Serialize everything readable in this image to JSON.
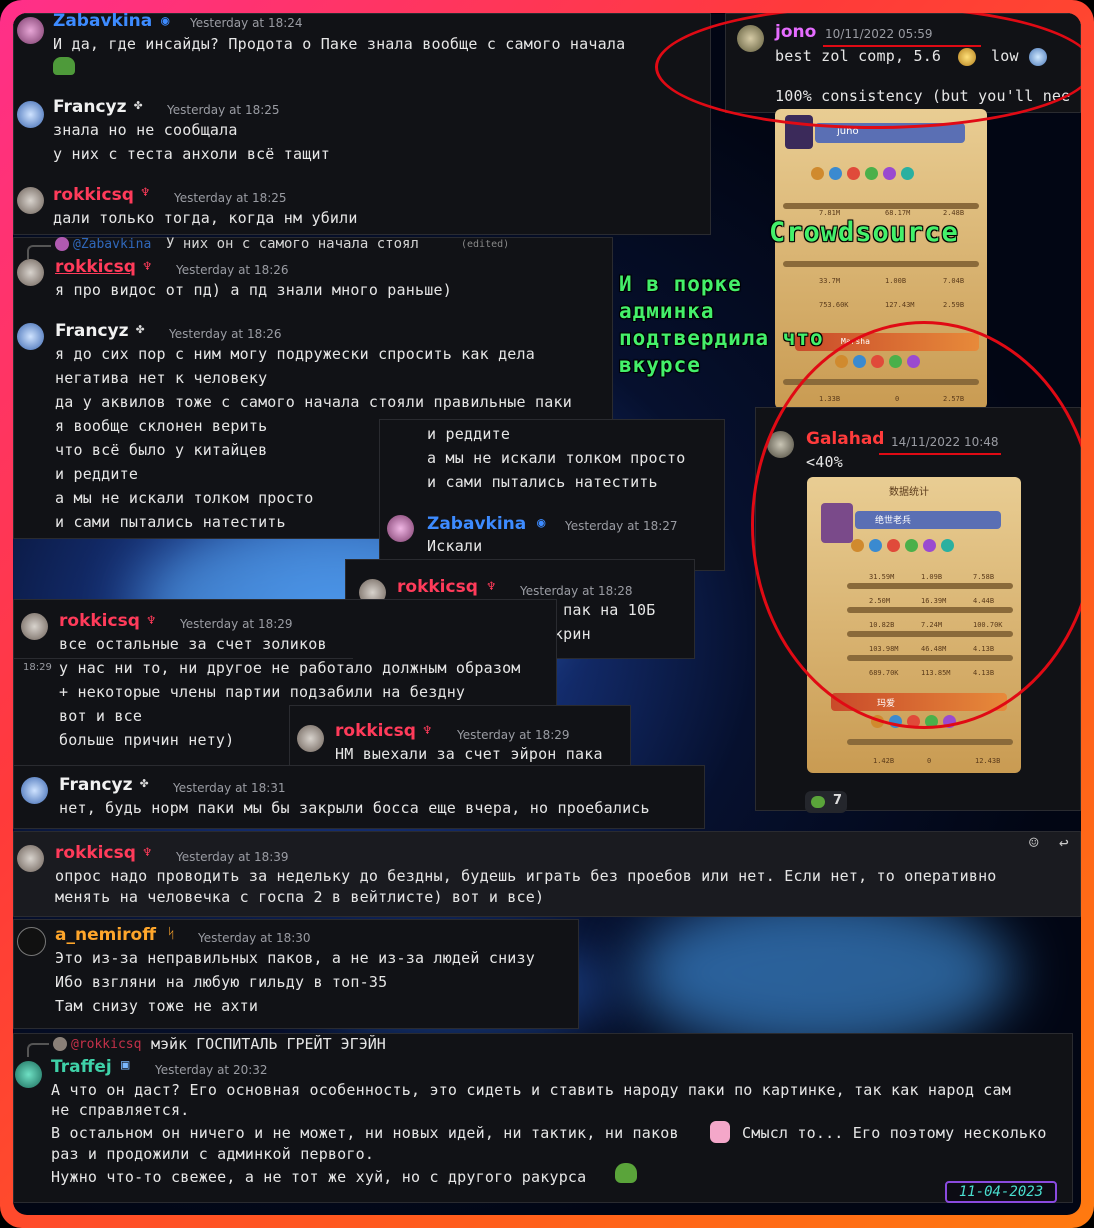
{
  "messages": {
    "m1": {
      "user": "Zabavkina",
      "time": "Yesterday at 18:24",
      "lines": [
        "И да, где инсайды? Продота о Паке знала вообще с самого начала"
      ]
    },
    "m2": {
      "user": "Francyz",
      "time": "Yesterday at 18:25",
      "lines": [
        "знала но не сообщала",
        "у них с теста анхоли всё тащит"
      ]
    },
    "m3": {
      "user": "rokkicsq",
      "time": "Yesterday at 18:25",
      "lines": [
        "дали только тогда, когда нм убили"
      ]
    },
    "m4": {
      "reply_user": "@Zabavkina",
      "reply_text": "У них он с самого начала стоял",
      "reply_edited": "(edited)",
      "user": "rokkicsq",
      "time": "Yesterday at 18:26",
      "lines": [
        "я про видос от пд) а пд знали много раньше)"
      ]
    },
    "m5": {
      "user": "Francyz",
      "time": "Yesterday at 18:26",
      "lines": [
        "я до сих пор с ним могу подружески спросить как дела",
        "негатива нет к человеку",
        "да у аквилов тоже с самого начала стояли правильные паки",
        "я вообще склонен верить",
        "что всё было у китайцев",
        "и реддите",
        "а мы не искали толком просто",
        "и сами пытались натестить"
      ]
    },
    "m6": {
      "lines": [
        "и реддите",
        "а мы не искали толком просто",
        "и сами пытались натестить"
      ],
      "user": "Zabavkina",
      "time": "Yesterday at 18:27",
      "reply": "Искали"
    },
    "m7": {
      "user": "rokkicsq",
      "time": "Yesterday at 18:28",
      "lines": [
        "но у НМ был эйрон пак на 10Б",
        "я сегодня видел скрин"
      ]
    },
    "m8": {
      "user": "rokkicsq",
      "time": "Yesterday at 18:29",
      "side_time": "18:29",
      "lines": [
        "все остальные за счет золиков",
        "у нас ни то, ни другое не работало должным образом",
        "+ некоторые члены партии подзабили на бездну",
        "вот и все",
        "больше причин нету)"
      ]
    },
    "m9": {
      "user": "rokkicsq",
      "time": "Yesterday at 18:29",
      "lines": [
        "НМ выехали за счет эйрон пака"
      ]
    },
    "m10": {
      "user": "Francyz",
      "time": "Yesterday at 18:31",
      "lines": [
        "нет, будь норм паки мы бы закрыли босса еще вчера, но проебались"
      ]
    },
    "m11": {
      "user": "rokkicsq",
      "time": "Yesterday at 18:39",
      "lines": [
        "опрос надо проводить за недельку до бездны, будешь играть без проебов или нет. Если нет, то оперативно",
        "менять на человечка с госпа 2 в вейтлисте) вот и все)"
      ]
    },
    "m12": {
      "user": "a_nemiroff",
      "time": "Yesterday at 18:30",
      "lines": [
        "Это из-за неправильных паков, а не из-за людей снизу",
        "Ибо взгляни на любую гильду в топ-35",
        "Там снизу тоже не ахти"
      ]
    },
    "m13": {
      "reply_user": "@rokkicsq",
      "reply_text": "мэйк ГОСПИТАЛЬ ГРЕЙТ ЭГЭЙН",
      "user": "Traffej",
      "time": "Yesterday at 20:32",
      "lines": [
        "А что он даст? Его основная особенность, это сидеть и ставить народу паки по картинке, так как народ сам",
        "не справляется.",
        "В остальном он ничего и не может, ни новых идей, ни тактик, ни паков",
        "Смысл то... Его поэтому несколько",
        "раз и продожили с админкой первого.",
        "Нужно что-то свежее, а не тот же хуй, но с другого ракурса"
      ]
    },
    "jono": {
      "user": "jono",
      "time": "10/11/2022 05:59",
      "line1": "best zol comp, 5.6",
      "line1b": "low",
      "line2": "100% consistency (but you'll nee"
    },
    "galahad": {
      "user": "Galahad",
      "time": "14/11/2022 10:48",
      "line1": "<40%",
      "reaction_count": "7"
    }
  },
  "game1": {
    "name": "juno",
    "tag": "Marsha",
    "stats": [
      "7.81M",
      "68.17M",
      "2.48B",
      "33.7M",
      "1.00B",
      "7.04B",
      "753.60K",
      "127.43M",
      "2.59B",
      "1.33B",
      "0",
      "2.57B"
    ]
  },
  "game2": {
    "title": "数据统计",
    "name": "绝世老兵",
    "tag": "玛爱",
    "stats": [
      "31.59M",
      "1.09B",
      "7.58B",
      "2.50M",
      "16.39M",
      "4.44B",
      "10.82B",
      "7.24M",
      "100.70K",
      "103.98M",
      "46.48M",
      "4.13B",
      "689.70K",
      "113.85M",
      "4.13B",
      "1.42B",
      "0",
      "12.43B"
    ]
  },
  "overlay": {
    "crowdsource": "Crowdsource",
    "note_lines": [
      "И в порке",
      "админка",
      "подтвердила что",
      "вкурсе"
    ],
    "date_stamp": "11-04-2023"
  },
  "colors": {
    "frame_gradient_start": "#ff2f8a",
    "frame_gradient_end": "#ff7a10",
    "circle": "#e00a14",
    "green_text": "#44f06a",
    "zabavkina": "#3d8bff",
    "rokkicsq": "#ff3b5a",
    "francyz": "#f1f1f1",
    "a_nemiroff": "#ffa62b",
    "traffej": "#3fd1a8",
    "jono": "#e56cff",
    "galahad": "#ff3b3b"
  },
  "icons": [
    "clover-badge-icon",
    "demon-badge-icon",
    "verified-badge-icon",
    "pepe-emoji-icon",
    "gold-coin-icon",
    "crystal-icon",
    "tiger-badge-icon",
    "unicorn-emoji-icon",
    "frog-emoji-icon",
    "add-reaction-icon",
    "reply-icon"
  ]
}
